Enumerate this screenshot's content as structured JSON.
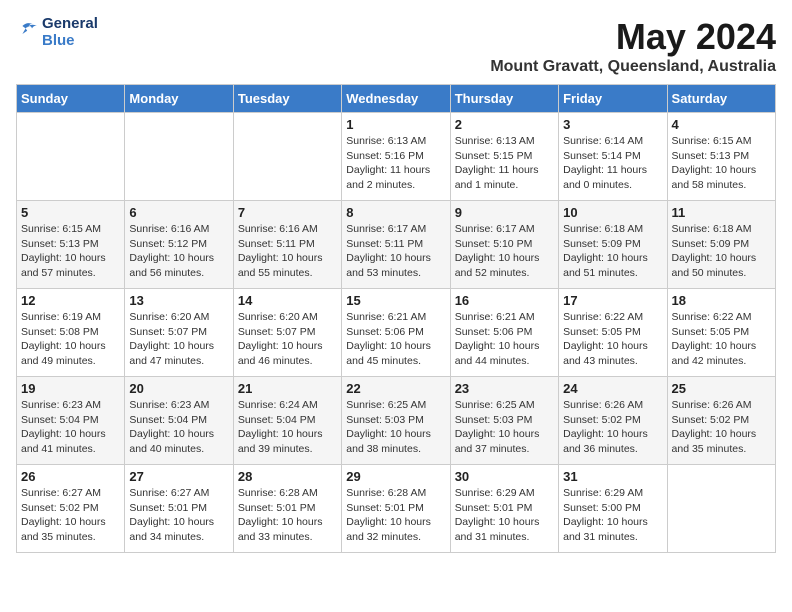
{
  "header": {
    "logo_line1": "General",
    "logo_line2": "Blue",
    "month_year": "May 2024",
    "location": "Mount Gravatt, Queensland, Australia"
  },
  "days_of_week": [
    "Sunday",
    "Monday",
    "Tuesday",
    "Wednesday",
    "Thursday",
    "Friday",
    "Saturday"
  ],
  "weeks": [
    [
      {
        "day": "",
        "content": ""
      },
      {
        "day": "",
        "content": ""
      },
      {
        "day": "",
        "content": ""
      },
      {
        "day": "1",
        "content": "Sunrise: 6:13 AM\nSunset: 5:16 PM\nDaylight: 11 hours\nand 2 minutes."
      },
      {
        "day": "2",
        "content": "Sunrise: 6:13 AM\nSunset: 5:15 PM\nDaylight: 11 hours\nand 1 minute."
      },
      {
        "day": "3",
        "content": "Sunrise: 6:14 AM\nSunset: 5:14 PM\nDaylight: 11 hours\nand 0 minutes."
      },
      {
        "day": "4",
        "content": "Sunrise: 6:15 AM\nSunset: 5:13 PM\nDaylight: 10 hours\nand 58 minutes."
      }
    ],
    [
      {
        "day": "5",
        "content": "Sunrise: 6:15 AM\nSunset: 5:13 PM\nDaylight: 10 hours\nand 57 minutes."
      },
      {
        "day": "6",
        "content": "Sunrise: 6:16 AM\nSunset: 5:12 PM\nDaylight: 10 hours\nand 56 minutes."
      },
      {
        "day": "7",
        "content": "Sunrise: 6:16 AM\nSunset: 5:11 PM\nDaylight: 10 hours\nand 55 minutes."
      },
      {
        "day": "8",
        "content": "Sunrise: 6:17 AM\nSunset: 5:11 PM\nDaylight: 10 hours\nand 53 minutes."
      },
      {
        "day": "9",
        "content": "Sunrise: 6:17 AM\nSunset: 5:10 PM\nDaylight: 10 hours\nand 52 minutes."
      },
      {
        "day": "10",
        "content": "Sunrise: 6:18 AM\nSunset: 5:09 PM\nDaylight: 10 hours\nand 51 minutes."
      },
      {
        "day": "11",
        "content": "Sunrise: 6:18 AM\nSunset: 5:09 PM\nDaylight: 10 hours\nand 50 minutes."
      }
    ],
    [
      {
        "day": "12",
        "content": "Sunrise: 6:19 AM\nSunset: 5:08 PM\nDaylight: 10 hours\nand 49 minutes."
      },
      {
        "day": "13",
        "content": "Sunrise: 6:20 AM\nSunset: 5:07 PM\nDaylight: 10 hours\nand 47 minutes."
      },
      {
        "day": "14",
        "content": "Sunrise: 6:20 AM\nSunset: 5:07 PM\nDaylight: 10 hours\nand 46 minutes."
      },
      {
        "day": "15",
        "content": "Sunrise: 6:21 AM\nSunset: 5:06 PM\nDaylight: 10 hours\nand 45 minutes."
      },
      {
        "day": "16",
        "content": "Sunrise: 6:21 AM\nSunset: 5:06 PM\nDaylight: 10 hours\nand 44 minutes."
      },
      {
        "day": "17",
        "content": "Sunrise: 6:22 AM\nSunset: 5:05 PM\nDaylight: 10 hours\nand 43 minutes."
      },
      {
        "day": "18",
        "content": "Sunrise: 6:22 AM\nSunset: 5:05 PM\nDaylight: 10 hours\nand 42 minutes."
      }
    ],
    [
      {
        "day": "19",
        "content": "Sunrise: 6:23 AM\nSunset: 5:04 PM\nDaylight: 10 hours\nand 41 minutes."
      },
      {
        "day": "20",
        "content": "Sunrise: 6:23 AM\nSunset: 5:04 PM\nDaylight: 10 hours\nand 40 minutes."
      },
      {
        "day": "21",
        "content": "Sunrise: 6:24 AM\nSunset: 5:04 PM\nDaylight: 10 hours\nand 39 minutes."
      },
      {
        "day": "22",
        "content": "Sunrise: 6:25 AM\nSunset: 5:03 PM\nDaylight: 10 hours\nand 38 minutes."
      },
      {
        "day": "23",
        "content": "Sunrise: 6:25 AM\nSunset: 5:03 PM\nDaylight: 10 hours\nand 37 minutes."
      },
      {
        "day": "24",
        "content": "Sunrise: 6:26 AM\nSunset: 5:02 PM\nDaylight: 10 hours\nand 36 minutes."
      },
      {
        "day": "25",
        "content": "Sunrise: 6:26 AM\nSunset: 5:02 PM\nDaylight: 10 hours\nand 35 minutes."
      }
    ],
    [
      {
        "day": "26",
        "content": "Sunrise: 6:27 AM\nSunset: 5:02 PM\nDaylight: 10 hours\nand 35 minutes."
      },
      {
        "day": "27",
        "content": "Sunrise: 6:27 AM\nSunset: 5:01 PM\nDaylight: 10 hours\nand 34 minutes."
      },
      {
        "day": "28",
        "content": "Sunrise: 6:28 AM\nSunset: 5:01 PM\nDaylight: 10 hours\nand 33 minutes."
      },
      {
        "day": "29",
        "content": "Sunrise: 6:28 AM\nSunset: 5:01 PM\nDaylight: 10 hours\nand 32 minutes."
      },
      {
        "day": "30",
        "content": "Sunrise: 6:29 AM\nSunset: 5:01 PM\nDaylight: 10 hours\nand 31 minutes."
      },
      {
        "day": "31",
        "content": "Sunrise: 6:29 AM\nSunset: 5:00 PM\nDaylight: 10 hours\nand 31 minutes."
      },
      {
        "day": "",
        "content": ""
      }
    ]
  ]
}
